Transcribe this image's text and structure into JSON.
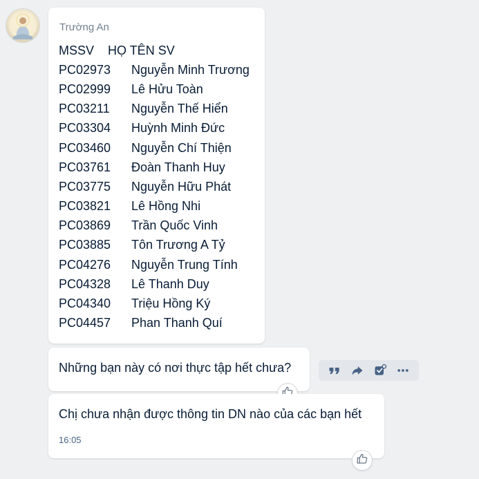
{
  "sender": {
    "name": "Trường An"
  },
  "message1": {
    "header": {
      "col1": "MSSV",
      "col2": "HỌ TÊN SV"
    },
    "rows": [
      {
        "id": "PC02973",
        "name": "Nguyễn Minh Trương"
      },
      {
        "id": "PC02999",
        "name": "Lê Hửu Toàn"
      },
      {
        "id": "PC03211",
        "name": "Nguyễn Thế Hiển"
      },
      {
        "id": "PC03304",
        "name": "Huỳnh Minh Đức"
      },
      {
        "id": "PC03460",
        "name": "Nguyễn Chí Thiện"
      },
      {
        "id": "PC03761",
        "name": "Đoàn Thanh Huy"
      },
      {
        "id": "PC03775",
        "name": "Nguyễn Hữu Phát"
      },
      {
        "id": "PC03821",
        "name": "Lê Hồng Nhi"
      },
      {
        "id": "PC03869",
        "name": "Trần Quốc Vinh"
      },
      {
        "id": "PC03885",
        "name": "Tôn Trương A Tỷ"
      },
      {
        "id": "PC04276",
        "name": "Nguyễn Trung Tính"
      },
      {
        "id": "PC04328",
        "name": "Lê Thanh Duy"
      },
      {
        "id": "PC04340",
        "name": "Triệu Hồng Ký"
      },
      {
        "id": "PC04457",
        "name": "Phan Thanh Quí"
      }
    ]
  },
  "message2": {
    "text": "Những bạn này có nơi thực tập hết chưa?"
  },
  "message3": {
    "text": "Chị chưa nhận được thông tin DN nào của các bạn hết",
    "time": "16:05"
  },
  "icons": {
    "reaction": "thumbs-up-icon",
    "actions": [
      "quote-icon",
      "forward-icon",
      "task-icon",
      "more-icon"
    ]
  },
  "colors": {
    "background": "#eef0f1",
    "bubble": "#ffffff",
    "text": "#081c36",
    "sender": "#72808e",
    "time": "#476285",
    "action_icon": "#476285"
  }
}
